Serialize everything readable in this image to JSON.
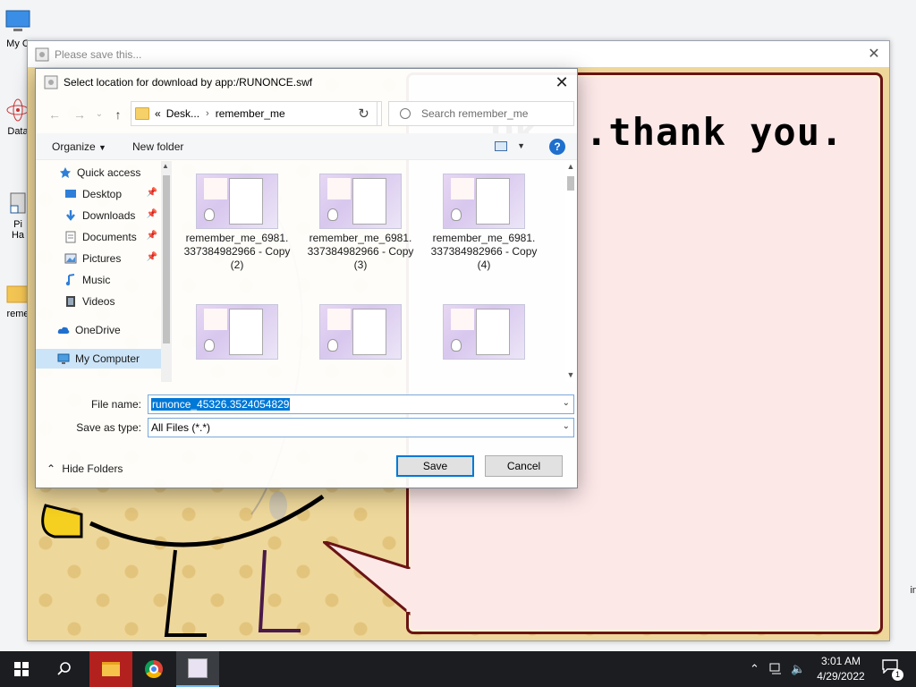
{
  "desktop": {
    "icons": [
      {
        "label": "My C"
      },
      {
        "label": "Data"
      },
      {
        "label": "Pi"
      },
      {
        "label": "Ha"
      },
      {
        "label": "reme"
      }
    ]
  },
  "flash_window": {
    "title": "Please save this...",
    "speech_text": "Ok...thank you.",
    "side_text": "in"
  },
  "save_dialog": {
    "title": "Select location for download by app:/RUNONCE.swf",
    "breadcrumb": {
      "prefix": "«",
      "parent": "Desk...",
      "current": "remember_me"
    },
    "search_placeholder": "Search remember_me",
    "toolbar": {
      "organize": "Organize",
      "new_folder": "New folder",
      "help": "?"
    },
    "nav": {
      "items": [
        {
          "label": "Quick access",
          "icon": "star-icon",
          "pinned": false
        },
        {
          "label": "Desktop",
          "icon": "desktop-icon",
          "pinned": true
        },
        {
          "label": "Downloads",
          "icon": "download-icon",
          "pinned": true
        },
        {
          "label": "Documents",
          "icon": "document-icon",
          "pinned": true
        },
        {
          "label": "Pictures",
          "icon": "picture-icon",
          "pinned": true
        },
        {
          "label": "Music",
          "icon": "music-icon",
          "pinned": false
        },
        {
          "label": "Videos",
          "icon": "video-icon",
          "pinned": false
        },
        {
          "label": "OneDrive",
          "icon": "cloud-icon",
          "pinned": false
        },
        {
          "label": "My Computer",
          "icon": "computer-icon",
          "pinned": false,
          "selected": true
        }
      ]
    },
    "files": [
      {
        "name": "remember_me_6981.337384982966 - Copy (2)"
      },
      {
        "name": "remember_me_6981.337384982966 - Copy (3)"
      },
      {
        "name": "remember_me_6981.337384982966 - Copy (4)"
      },
      {
        "name": ""
      },
      {
        "name": ""
      },
      {
        "name": ""
      }
    ],
    "file_name_label": "File name:",
    "file_name_value": "runonce_45326.3524054829",
    "save_type_label": "Save as type:",
    "save_type_value": "All Files (*.*)",
    "hide_folders": "Hide Folders",
    "save_button": "Save",
    "cancel_button": "Cancel"
  },
  "taskbar": {
    "time": "3:01 AM",
    "date": "4/29/2022",
    "notification_count": "1"
  },
  "colors": {
    "speech_border": "#6a1414",
    "speech_fill": "#fde8e8",
    "game_bg": "#eed79a",
    "accent": "#0078d7",
    "taskbar": "#1b1d20"
  }
}
